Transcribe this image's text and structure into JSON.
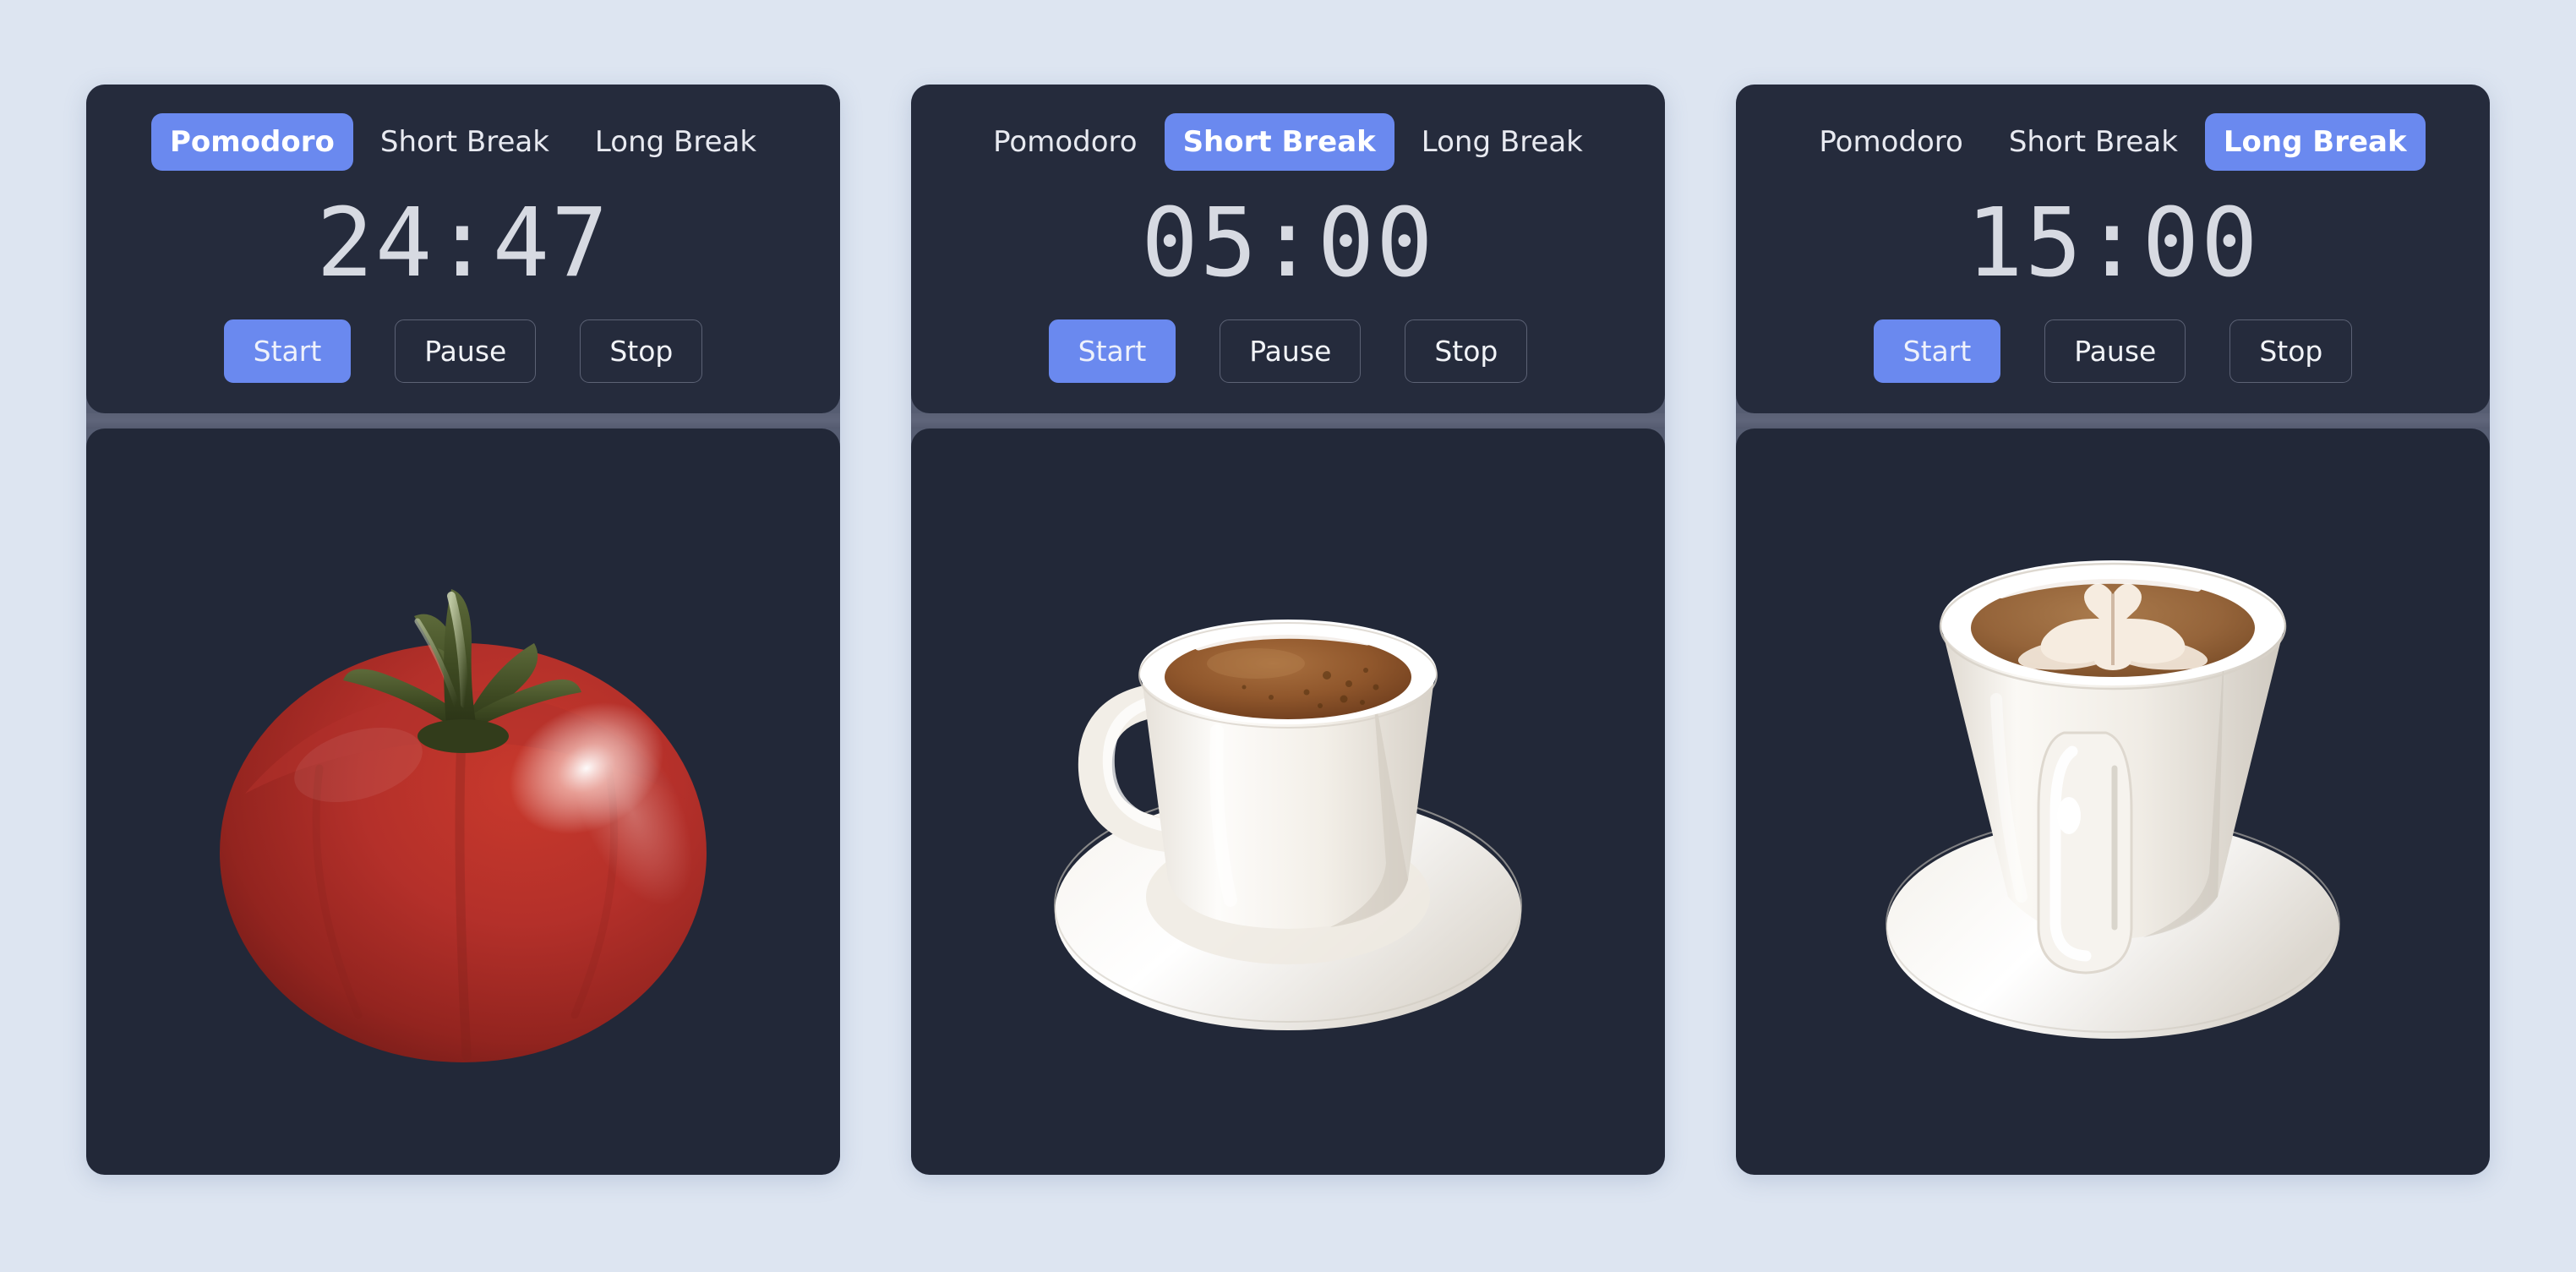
{
  "theme": {
    "page_background": "#dde5f1",
    "card_surface": "#252b3c",
    "art_surface": "#222838",
    "separator": "#5b6176",
    "accent": "#6a89ef",
    "text_primary": "#e8eaf1",
    "time_text": "#d7dae2"
  },
  "controls": {
    "start_label": "Start",
    "pause_label": "Pause",
    "stop_label": "Stop"
  },
  "tab_labels": {
    "pomodoro": "Pomodoro",
    "short_break": "Short Break",
    "long_break": "Long Break"
  },
  "cards": [
    {
      "id": "pomodoro-card",
      "tabs": [
        {
          "label": "Pomodoro",
          "active": true
        },
        {
          "label": "Short Break",
          "active": false
        },
        {
          "label": "Long Break",
          "active": false
        }
      ],
      "time": "24:47",
      "minutes": 24,
      "seconds": 47,
      "buttons": {
        "start": "Start",
        "pause": "Pause",
        "stop": "Stop"
      },
      "illustration": "tomato-icon"
    },
    {
      "id": "short-break-card",
      "tabs": [
        {
          "label": "Pomodoro",
          "active": false
        },
        {
          "label": "Short Break",
          "active": true
        },
        {
          "label": "Long Break",
          "active": false
        }
      ],
      "time": "05:00",
      "minutes": 5,
      "seconds": 0,
      "buttons": {
        "start": "Start",
        "pause": "Pause",
        "stop": "Stop"
      },
      "illustration": "espresso-cup-icon"
    },
    {
      "id": "long-break-card",
      "tabs": [
        {
          "label": "Pomodoro",
          "active": false
        },
        {
          "label": "Short Break",
          "active": false
        },
        {
          "label": "Long Break",
          "active": true
        }
      ],
      "time": "15:00",
      "minutes": 15,
      "seconds": 0,
      "buttons": {
        "start": "Start",
        "pause": "Pause",
        "stop": "Stop"
      },
      "illustration": "latte-cup-icon"
    }
  ]
}
